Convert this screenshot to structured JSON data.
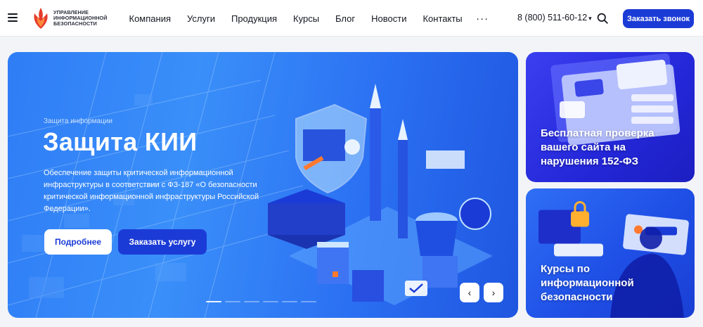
{
  "header": {
    "logo_lines": [
      "Управление",
      "информационной",
      "безопасности"
    ],
    "nav": [
      "Компания",
      "Услуги",
      "Продукция",
      "Курсы",
      "Блог",
      "Новости",
      "Контакты"
    ],
    "more": "···",
    "phone": "8 (800) 511-60-12",
    "phone_caret": "▾",
    "cta": "Заказать звонок",
    "brand_color": "#1b3bd6"
  },
  "hero": {
    "eyebrow": "Защита информации",
    "title": "Защита КИИ",
    "description": "Обеспечение защиты критической информационной инфраструктуры в соответствии с ФЗ-187 «О безопасности критической информационной инфраструктуры Российской Федерации».",
    "btn_more": "Подробнее",
    "btn_order": "Заказать услугу",
    "prev_arrow": "‹",
    "next_arrow": "›",
    "slide_count": 6,
    "active_slide": 1
  },
  "cards": [
    {
      "title": "Бесплатная проверка вашего сайта на нарушения 152-ФЗ"
    },
    {
      "title": "Курсы по информационной безопасности"
    }
  ],
  "icons": [
    "menu-icon",
    "logo-icon",
    "more-icon",
    "chevron-down-icon",
    "search-icon",
    "chevron-left-icon",
    "chevron-right-icon"
  ]
}
